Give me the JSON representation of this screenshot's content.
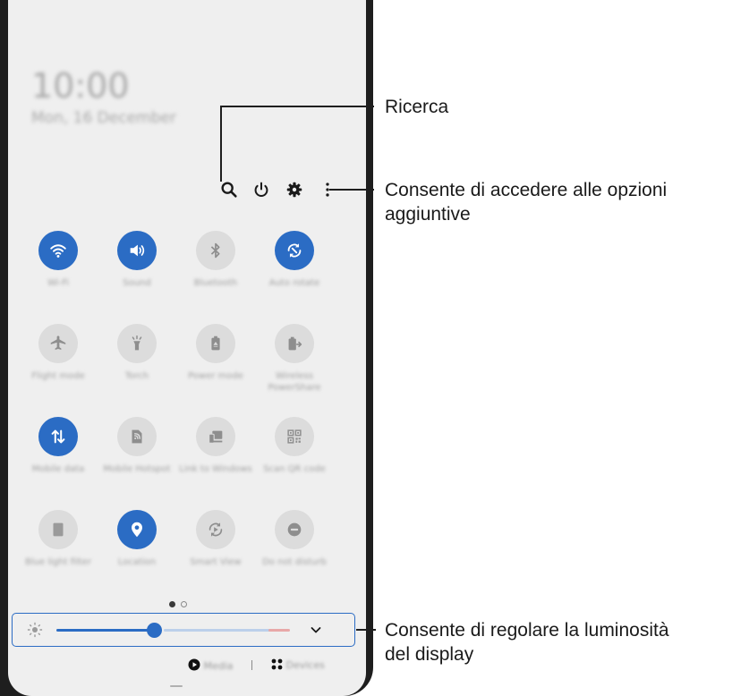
{
  "status": {
    "time": "10:00",
    "date": "Mon, 16 December"
  },
  "quick_panel": {
    "top_icons": [
      "search-icon",
      "power-icon",
      "settings-icon",
      "more-options-icon"
    ],
    "tiles": [
      {
        "name": "wifi",
        "label": "Wi-Fi",
        "active": true
      },
      {
        "name": "sound",
        "label": "Sound",
        "active": true
      },
      {
        "name": "bluetooth",
        "label": "Bluetooth",
        "active": false
      },
      {
        "name": "auto-rotate",
        "label": "Auto rotate",
        "active": true
      },
      {
        "name": "flight-mode",
        "label": "Flight mode",
        "active": false
      },
      {
        "name": "torch",
        "label": "Torch",
        "active": false
      },
      {
        "name": "power-mode",
        "label": "Power mode",
        "active": false
      },
      {
        "name": "wireless-powershare",
        "label": "Wireless PowerShare",
        "active": false
      },
      {
        "name": "mobile-data",
        "label": "Mobile data",
        "active": true
      },
      {
        "name": "mobile-hotspot",
        "label": "Mobile Hotspot",
        "active": false
      },
      {
        "name": "link-to-windows",
        "label": "Link to Windows",
        "active": false
      },
      {
        "name": "scan-qr-code",
        "label": "Scan QR code",
        "active": false
      },
      {
        "name": "blue-light-filter",
        "label": "Blue light filter",
        "active": false
      },
      {
        "name": "location",
        "label": "Location",
        "active": true
      },
      {
        "name": "smart-view",
        "label": "Smart View",
        "active": false
      },
      {
        "name": "do-not-disturb",
        "label": "Do not disturb",
        "active": false
      }
    ],
    "page_count": 2,
    "current_page": 1,
    "brightness": {
      "level": 0.42
    },
    "media_label": "Media",
    "devices_label": "Devices"
  },
  "callouts": {
    "search": "Ricerca",
    "more_options_line1": "Consente di accedere alle opzioni",
    "more_options_line2": "aggiuntive",
    "brightness_line1": "Consente di regolare la luminosità",
    "brightness_line2": "del display"
  },
  "colors": {
    "accent": "#2b6cc4",
    "inactive_tile": "#dcdcdc",
    "panel_bg": "#efefef"
  }
}
